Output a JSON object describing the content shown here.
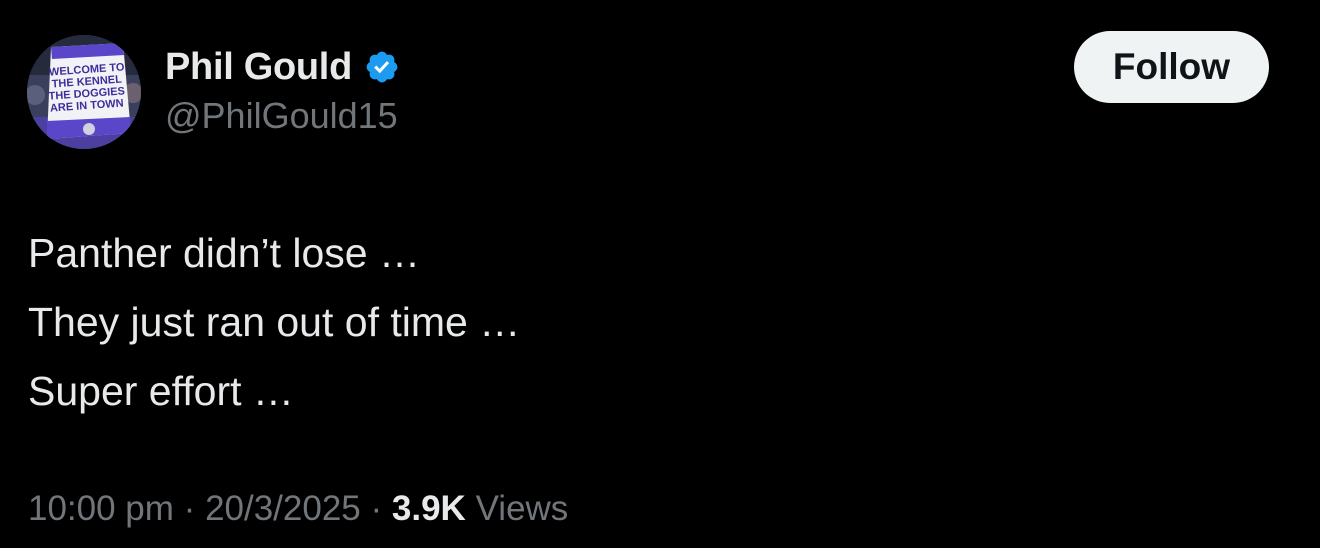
{
  "user": {
    "display_name": "Phil Gould",
    "handle": "@PhilGould15",
    "verified": true,
    "avatar_icon": "avatar-photo",
    "avatar_text": "WELCOME TO THE KENNEL THE DOGGIES ARE IN TOWN"
  },
  "follow_button": {
    "label": "Follow"
  },
  "tweet": {
    "lines": [
      "Panther didn’t lose …",
      "They just ran out of time …",
      "Super effort …"
    ]
  },
  "meta": {
    "time": "10:00 pm",
    "separator": "·",
    "date": "20/3/2025",
    "views_count": "3.9K",
    "views_label": "Views"
  },
  "colors": {
    "background": "#000000",
    "primary_text": "#e7e9ea",
    "secondary_text": "#71767b",
    "verified_blue": "#1d9bf0",
    "button_bg": "#eff3f4",
    "button_text": "#0f1419"
  }
}
